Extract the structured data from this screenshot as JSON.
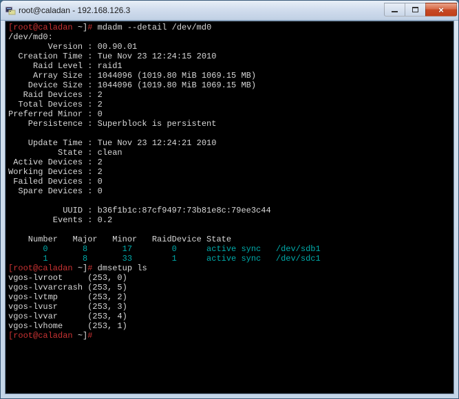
{
  "window": {
    "title": "root@caladan - 192.168.126.3"
  },
  "prompt": {
    "user_host": "[root@caladan",
    "cwd_close": " ~]",
    "hash": "#"
  },
  "commands": {
    "mdadm": " mdadm --detail /dev/md0",
    "dmsetup": " dmsetup ls",
    "empty": ""
  },
  "mdadm": {
    "device_line": "/dev/md0:",
    "pairs": [
      "        Version : 00.90.01",
      "  Creation Time : Tue Nov 23 12:24:15 2010",
      "     Raid Level : raid1",
      "     Array Size : 1044096 (1019.80 MiB 1069.15 MB)",
      "    Device Size : 1044096 (1019.80 MiB 1069.15 MB)",
      "   Raid Devices : 2",
      "  Total Devices : 2",
      "Preferred Minor : 0",
      "    Persistence : Superblock is persistent",
      "",
      "    Update Time : Tue Nov 23 12:24:21 2010",
      "          State : clean",
      " Active Devices : 2",
      "Working Devices : 2",
      " Failed Devices : 0",
      "  Spare Devices : 0",
      "",
      "           UUID : b36f1b1c:87cf9497:73b81e8c:79ee3c44",
      "         Events : 0.2",
      ""
    ],
    "table_header": "    Number   Major   Minor   RaidDevice State",
    "table_rows": [
      "       0       8       17        0      active sync   /dev/sdb1",
      "       1       8       33        1      active sync   /dev/sdc1"
    ]
  },
  "dmsetup": {
    "rows": [
      "vgos-lvroot     (253, 0)",
      "vgos-lvvarcrash (253, 5)",
      "vgos-lvtmp      (253, 2)",
      "vgos-lvusr      (253, 3)",
      "vgos-lvvar      (253, 4)",
      "vgos-lvhome     (253, 1)"
    ]
  }
}
